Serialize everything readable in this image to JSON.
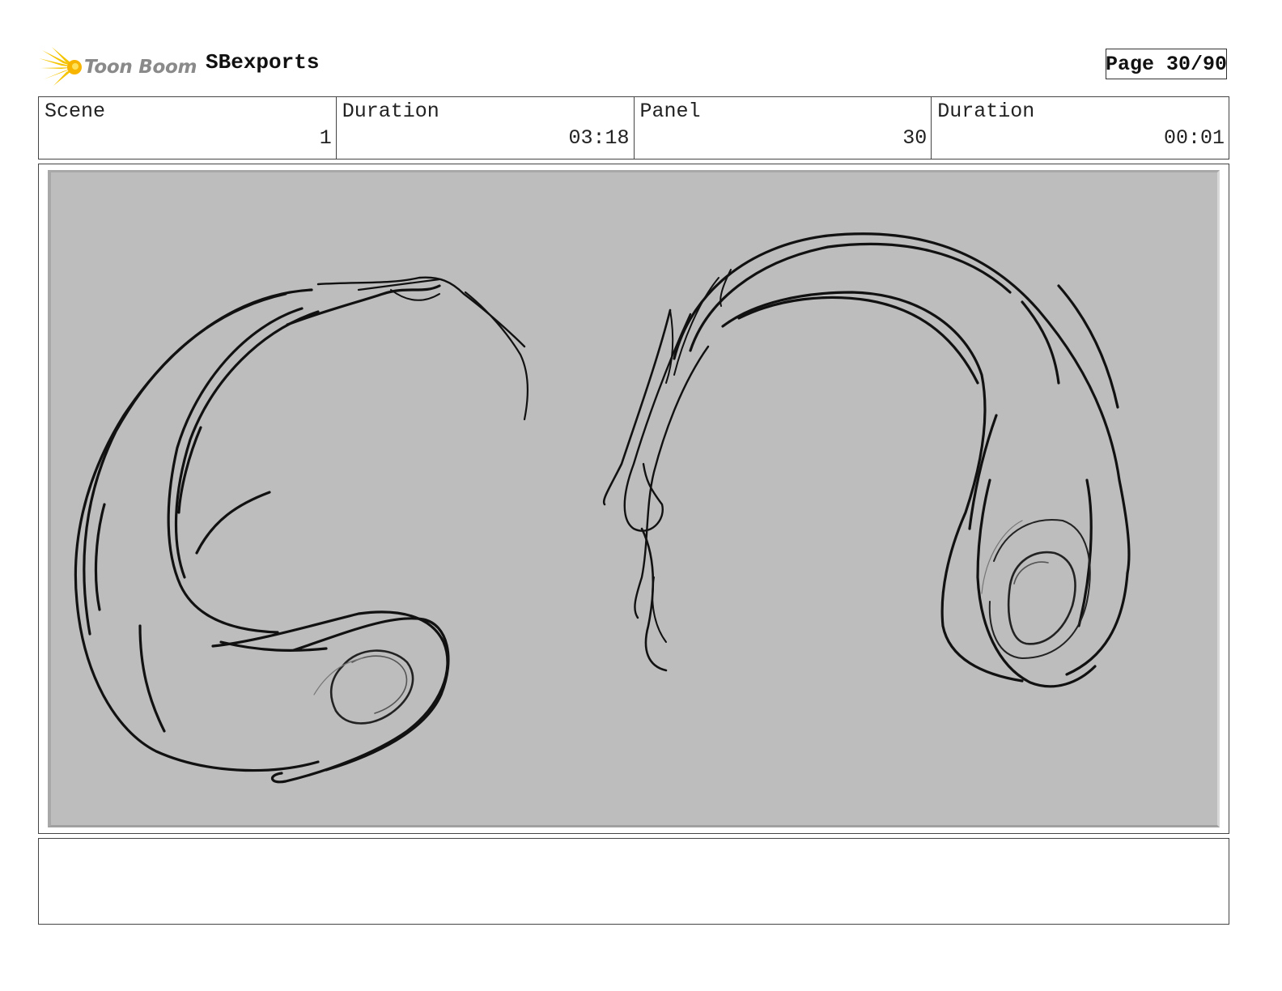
{
  "header": {
    "logo_text": "Toon Boom",
    "project_name": "SBexports",
    "page_indicator": "Page 30/90"
  },
  "info": {
    "scene_label": "Scene",
    "scene_value": "1",
    "scene_duration_label": "Duration",
    "scene_duration_value": "03:18",
    "panel_label": "Panel",
    "panel_value": "30",
    "panel_duration_label": "Duration",
    "panel_duration_value": "00:01"
  },
  "notes": {
    "text": ""
  },
  "colors": {
    "panel_background": "#bdbdbd",
    "sketch_stroke": "#111111",
    "logo_yellow": "#f5c400",
    "logo_text_gray": "#8a8a8a"
  }
}
